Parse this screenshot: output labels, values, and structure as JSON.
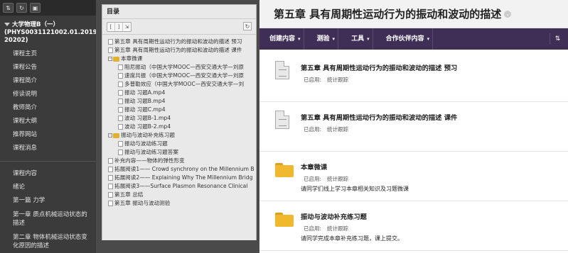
{
  "sidebar": {
    "toolbar": [
      "⇅",
      "↻",
      "▣"
    ],
    "course_title": "大学物理B（一）(PHYS0031121002.01.2019-20202)",
    "nav_top": [
      "课程主页",
      "课程公告",
      "课程简介",
      "修读说明",
      "教师简介",
      "课程大纲",
      "推荐网站",
      "课程消息"
    ],
    "nav_bottom": [
      "课程内容",
      "绪论",
      "第一篇 力学",
      "第一章 质点机械运动状态的描述",
      "第二章 物体机械运动状态变化原因的描述"
    ]
  },
  "toc": {
    "title": "目录",
    "rows": [
      {
        "level": 0,
        "type": "doc",
        "label": "第五章 具有周期性运动行为的振动和波动的描述 预习"
      },
      {
        "level": 0,
        "type": "doc",
        "label": "第五章 具有周期性运动行为的振动和波动的描述 课件"
      },
      {
        "level": 0,
        "type": "folder",
        "label": "本章微课"
      },
      {
        "level": 1,
        "type": "doc",
        "label": "阻尼振动（中国大学MOOC—西安交通大学—刘原"
      },
      {
        "level": 1,
        "type": "doc",
        "label": "速度共振（中国大学MOOC—西安交通大学—刘原"
      },
      {
        "level": 1,
        "type": "doc",
        "label": "多普勒效应（中国大学MOOC—西安交通大学—刘"
      },
      {
        "level": 1,
        "type": "doc",
        "label": "振动 习题A.mp4"
      },
      {
        "level": 1,
        "type": "doc",
        "label": "振动 习题B.mp4"
      },
      {
        "level": 1,
        "type": "doc",
        "label": "振动 习题C.mp4"
      },
      {
        "level": 1,
        "type": "doc",
        "label": "波动 习题B-1.mp4"
      },
      {
        "level": 1,
        "type": "doc",
        "label": "波动 习题B-2.mp4"
      },
      {
        "level": 0,
        "type": "folder",
        "label": "振动与波动补充练习题"
      },
      {
        "level": 1,
        "type": "doc",
        "label": "振动与波动练习题"
      },
      {
        "level": 1,
        "type": "doc",
        "label": "振动与波动练习题答案"
      },
      {
        "level": 0,
        "type": "doc",
        "label": "补充内容——物体的弹性形变"
      },
      {
        "level": 0,
        "type": "doc",
        "label": "拓展阅读1—— Crowd synchrony on the Millennium B"
      },
      {
        "level": 0,
        "type": "doc",
        "label": "拓展阅读2—— Explaining Why The Millennium Bridg"
      },
      {
        "level": 0,
        "type": "doc",
        "label": "拓展阅读3——Surface Plasmon Resonance Clinical"
      },
      {
        "level": 0,
        "type": "doc",
        "label": "第五章 总结"
      },
      {
        "level": 0,
        "type": "doc",
        "label": "第五章 振动与波动测验"
      }
    ]
  },
  "main": {
    "title": "第五章 具有周期性运动行为的振动和波动的描述",
    "actions": [
      "创建内容",
      "测验",
      "工具",
      "合作伙伴内容"
    ],
    "items": [
      {
        "icon": "file",
        "title": "第五章 具有周期性运动行为的振动和波动的描述 预习",
        "meta_label": "已启用:",
        "meta_value": "统计跟踪",
        "desc": ""
      },
      {
        "icon": "file",
        "title": "第五章 具有周期性运动行为的振动和波动的描述 课件",
        "meta_label": "已启用:",
        "meta_value": "统计跟踪",
        "desc": ""
      },
      {
        "icon": "folder",
        "title": "本章微课",
        "meta_label": "已启用:",
        "meta_value": "统计跟踪",
        "desc": "请同学们线上学习本章相关知识及习题微课"
      },
      {
        "icon": "folder",
        "title": "振动与波动补充练习题",
        "meta_label": "已启用:",
        "meta_value": "统计跟踪",
        "desc": "请同学完成本章补充练习题，课上提交。"
      }
    ]
  }
}
